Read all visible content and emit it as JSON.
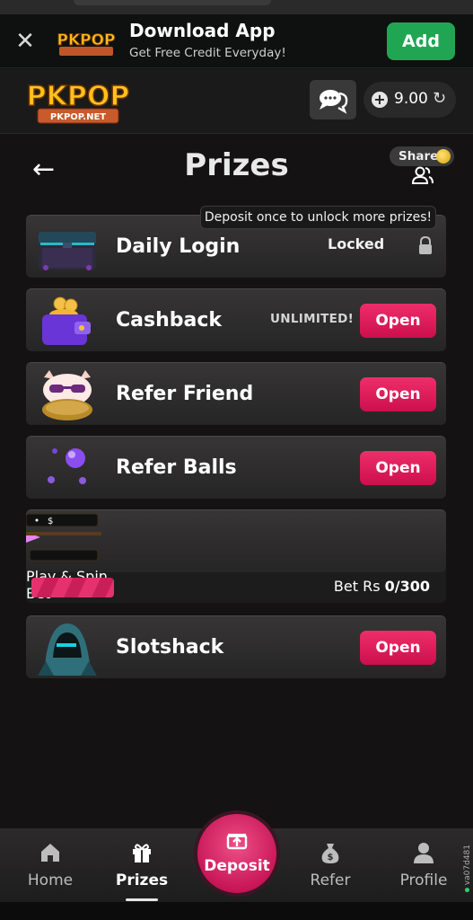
{
  "banner": {
    "title": "Download App",
    "subtitle": "Get Free Credit Everyday!",
    "add_label": "Add",
    "logo_text": "PKPOP"
  },
  "header": {
    "logo_text": "PKPOP",
    "logo_sub": "PKPOP.NET",
    "balance": "9.00"
  },
  "page": {
    "title": "Prizes",
    "share_label": "Share",
    "tooltip": "Deposit once to unlock more prizes!"
  },
  "prizes": {
    "daily_login": {
      "label": "Daily Login",
      "status": "Locked"
    },
    "cashback": {
      "label": "Cashback",
      "badge": "UNLIMITED!",
      "button": "Open"
    },
    "refer_friend": {
      "label": "Refer Friend",
      "button": "Open"
    },
    "refer_balls": {
      "label": "Refer Balls",
      "button": "Open"
    },
    "play_spin": {
      "label": "Play & Spin",
      "button": "Bet",
      "progress_text_prefix": "Bet Rs",
      "progress_text_value": "0/300",
      "progress": 0
    },
    "slotshack": {
      "label": "Slotshack",
      "button": "Open"
    }
  },
  "nav": {
    "home": "Home",
    "prizes": "Prizes",
    "deposit": "Deposit",
    "refer": "Refer",
    "profile": "Profile"
  },
  "version": "va07d481",
  "colors": {
    "accent": "#d81a56",
    "add_green": "#20a653",
    "background": "#141212"
  }
}
